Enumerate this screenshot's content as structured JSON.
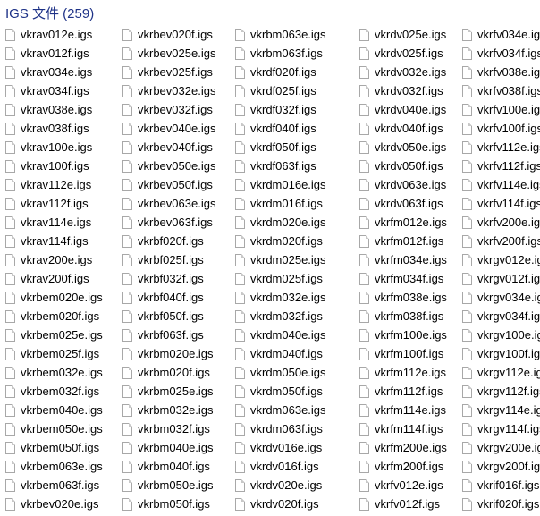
{
  "group": {
    "title": "IGS 文件 (259)"
  },
  "icons": {
    "file": "file-icon"
  },
  "columns": [
    [
      "vkrav012e.igs",
      "vkrav012f.igs",
      "vkrav034e.igs",
      "vkrav034f.igs",
      "vkrav038e.igs",
      "vkrav038f.igs",
      "vkrav100e.igs",
      "vkrav100f.igs",
      "vkrav112e.igs",
      "vkrav112f.igs",
      "vkrav114e.igs",
      "vkrav114f.igs",
      "vkrav200e.igs",
      "vkrav200f.igs",
      "vkrbem020e.igs",
      "vkrbem020f.igs",
      "vkrbem025e.igs",
      "vkrbem025f.igs",
      "vkrbem032e.igs",
      "vkrbem032f.igs",
      "vkrbem040e.igs",
      "vkrbem050e.igs",
      "vkrbem050f.igs",
      "vkrbem063e.igs",
      "vkrbem063f.igs",
      "vkrbev020e.igs"
    ],
    [
      "vkrbev020f.igs",
      "vkrbev025e.igs",
      "vkrbev025f.igs",
      "vkrbev032e.igs",
      "vkrbev032f.igs",
      "vkrbev040e.igs",
      "vkrbev040f.igs",
      "vkrbev050e.igs",
      "vkrbev050f.igs",
      "vkrbev063e.igs",
      "vkrbev063f.igs",
      "vkrbf020f.igs",
      "vkrbf025f.igs",
      "vkrbf032f.igs",
      "vkrbf040f.igs",
      "vkrbf050f.igs",
      "vkrbf063f.igs",
      "vkrbm020e.igs",
      "vkrbm020f.igs",
      "vkrbm025e.igs",
      "vkrbm032e.igs",
      "vkrbm032f.igs",
      "vkrbm040e.igs",
      "vkrbm040f.igs",
      "vkrbm050e.igs",
      "vkrbm050f.igs"
    ],
    [
      "vkrbm063e.igs",
      "vkrbm063f.igs",
      "vkrdf020f.igs",
      "vkrdf025f.igs",
      "vkrdf032f.igs",
      "vkrdf040f.igs",
      "vkrdf050f.igs",
      "vkrdf063f.igs",
      "vkrdm016e.igs",
      "vkrdm016f.igs",
      "vkrdm020e.igs",
      "vkrdm020f.igs",
      "vkrdm025e.igs",
      "vkrdm025f.igs",
      "vkrdm032e.igs",
      "vkrdm032f.igs",
      "vkrdm040e.igs",
      "vkrdm040f.igs",
      "vkrdm050e.igs",
      "vkrdm050f.igs",
      "vkrdm063e.igs",
      "vkrdm063f.igs",
      "vkrdv016e.igs",
      "vkrdv016f.igs",
      "vkrdv020e.igs",
      "vkrdv020f.igs"
    ],
    [
      "vkrdv025e.igs",
      "vkrdv025f.igs",
      "vkrdv032e.igs",
      "vkrdv032f.igs",
      "vkrdv040e.igs",
      "vkrdv040f.igs",
      "vkrdv050e.igs",
      "vkrdv050f.igs",
      "vkrdv063e.igs",
      "vkrdv063f.igs",
      "vkrfm012e.igs",
      "vkrfm012f.igs",
      "vkrfm034e.igs",
      "vkrfm034f.igs",
      "vkrfm038e.igs",
      "vkrfm038f.igs",
      "vkrfm100e.igs",
      "vkrfm100f.igs",
      "vkrfm112e.igs",
      "vkrfm112f.igs",
      "vkrfm114e.igs",
      "vkrfm114f.igs",
      "vkrfm200e.igs",
      "vkrfm200f.igs",
      "vkrfv012e.igs",
      "vkrfv012f.igs"
    ],
    [
      "vkrfv034e.igs",
      "vkrfv034f.igs",
      "vkrfv038e.igs",
      "vkrfv038f.igs",
      "vkrfv100e.igs",
      "vkrfv100f.igs",
      "vkrfv112e.igs",
      "vkrfv112f.igs",
      "vkrfv114e.igs",
      "vkrfv114f.igs",
      "vkrfv200e.igs",
      "vkrfv200f.igs",
      "vkrgv012e.igs",
      "vkrgv012f.igs",
      "vkrgv034e.igs",
      "vkrgv034f.igs",
      "vkrgv100e.igs",
      "vkrgv100f.igs",
      "vkrgv112e.igs",
      "vkrgv112f.igs",
      "vkrgv114e.igs",
      "vkrgv114f.igs",
      "vkrgv200e.igs",
      "vkrgv200f.igs",
      "vkrif016f.igs",
      "vkrif020f.igs"
    ]
  ]
}
